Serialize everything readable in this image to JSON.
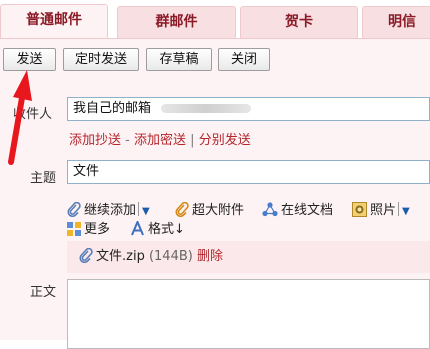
{
  "tabs": [
    {
      "label": "普通邮件",
      "active": true
    },
    {
      "label": "群邮件",
      "active": false
    },
    {
      "label": "贺卡",
      "active": false
    },
    {
      "label": "明信",
      "active": false
    }
  ],
  "toolbar": {
    "send": "发送",
    "scheduled_send": "定时发送",
    "save_draft": "存草稿",
    "close": "关闭"
  },
  "form": {
    "recipient_label": "收件人",
    "recipient_value": "我自己的邮箱",
    "add_cc": "添加抄送",
    "dash": "-",
    "add_bcc": "添加密送",
    "pipe": "|",
    "separate_send": "分别发送",
    "subject_label": "主题",
    "subject_value": "文件",
    "body_label": "正文"
  },
  "attach_tools": {
    "continue_add": "继续添加",
    "large_attachment": "超大附件",
    "online_docs": "在线文档",
    "photos": "照片",
    "more": "更多",
    "format": "格式↓"
  },
  "attachment": {
    "file_name": "文件.zip",
    "file_size": "(144B)",
    "delete": "删除"
  },
  "colors": {
    "accent": "#b3262c",
    "tab_text": "#8b1a26",
    "panel_bg": "#fdf3f4",
    "arrow": "#e8161d"
  },
  "icons": [
    "paperclip-icon",
    "large-file-icon",
    "online-docs-icon",
    "photo-icon",
    "more-grid-icon",
    "format-icon",
    "dropdown-caret-icon"
  ]
}
